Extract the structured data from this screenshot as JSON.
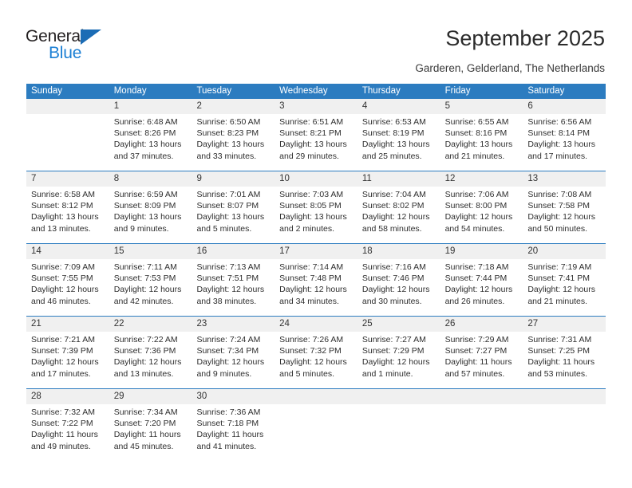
{
  "brand": {
    "name_dark": "General",
    "name_blue": "Blue",
    "accent_blue": "#2c7cc0",
    "logo_blue": "#1b7fd4"
  },
  "header": {
    "title": "September 2025",
    "subtitle": "Garderen, Gelderland, The Netherlands"
  },
  "calendar": {
    "weekdays": [
      "Sunday",
      "Monday",
      "Tuesday",
      "Wednesday",
      "Thursday",
      "Friday",
      "Saturday"
    ],
    "header_bg": "#2c7cc0",
    "daynum_bg": "#f0f0f0",
    "weeks": [
      {
        "days": [
          {
            "num": "",
            "empty": true,
            "l1": "",
            "l2": "",
            "l3": "",
            "l4": ""
          },
          {
            "num": "1",
            "empty": false,
            "l1": "Sunrise: 6:48 AM",
            "l2": "Sunset: 8:26 PM",
            "l3": "Daylight: 13 hours",
            "l4": "and 37 minutes."
          },
          {
            "num": "2",
            "empty": false,
            "l1": "Sunrise: 6:50 AM",
            "l2": "Sunset: 8:23 PM",
            "l3": "Daylight: 13 hours",
            "l4": "and 33 minutes."
          },
          {
            "num": "3",
            "empty": false,
            "l1": "Sunrise: 6:51 AM",
            "l2": "Sunset: 8:21 PM",
            "l3": "Daylight: 13 hours",
            "l4": "and 29 minutes."
          },
          {
            "num": "4",
            "empty": false,
            "l1": "Sunrise: 6:53 AM",
            "l2": "Sunset: 8:19 PM",
            "l3": "Daylight: 13 hours",
            "l4": "and 25 minutes."
          },
          {
            "num": "5",
            "empty": false,
            "l1": "Sunrise: 6:55 AM",
            "l2": "Sunset: 8:16 PM",
            "l3": "Daylight: 13 hours",
            "l4": "and 21 minutes."
          },
          {
            "num": "6",
            "empty": false,
            "l1": "Sunrise: 6:56 AM",
            "l2": "Sunset: 8:14 PM",
            "l3": "Daylight: 13 hours",
            "l4": "and 17 minutes."
          }
        ]
      },
      {
        "days": [
          {
            "num": "7",
            "empty": false,
            "l1": "Sunrise: 6:58 AM",
            "l2": "Sunset: 8:12 PM",
            "l3": "Daylight: 13 hours",
            "l4": "and 13 minutes."
          },
          {
            "num": "8",
            "empty": false,
            "l1": "Sunrise: 6:59 AM",
            "l2": "Sunset: 8:09 PM",
            "l3": "Daylight: 13 hours",
            "l4": "and 9 minutes."
          },
          {
            "num": "9",
            "empty": false,
            "l1": "Sunrise: 7:01 AM",
            "l2": "Sunset: 8:07 PM",
            "l3": "Daylight: 13 hours",
            "l4": "and 5 minutes."
          },
          {
            "num": "10",
            "empty": false,
            "l1": "Sunrise: 7:03 AM",
            "l2": "Sunset: 8:05 PM",
            "l3": "Daylight: 13 hours",
            "l4": "and 2 minutes."
          },
          {
            "num": "11",
            "empty": false,
            "l1": "Sunrise: 7:04 AM",
            "l2": "Sunset: 8:02 PM",
            "l3": "Daylight: 12 hours",
            "l4": "and 58 minutes."
          },
          {
            "num": "12",
            "empty": false,
            "l1": "Sunrise: 7:06 AM",
            "l2": "Sunset: 8:00 PM",
            "l3": "Daylight: 12 hours",
            "l4": "and 54 minutes."
          },
          {
            "num": "13",
            "empty": false,
            "l1": "Sunrise: 7:08 AM",
            "l2": "Sunset: 7:58 PM",
            "l3": "Daylight: 12 hours",
            "l4": "and 50 minutes."
          }
        ]
      },
      {
        "days": [
          {
            "num": "14",
            "empty": false,
            "l1": "Sunrise: 7:09 AM",
            "l2": "Sunset: 7:55 PM",
            "l3": "Daylight: 12 hours",
            "l4": "and 46 minutes."
          },
          {
            "num": "15",
            "empty": false,
            "l1": "Sunrise: 7:11 AM",
            "l2": "Sunset: 7:53 PM",
            "l3": "Daylight: 12 hours",
            "l4": "and 42 minutes."
          },
          {
            "num": "16",
            "empty": false,
            "l1": "Sunrise: 7:13 AM",
            "l2": "Sunset: 7:51 PM",
            "l3": "Daylight: 12 hours",
            "l4": "and 38 minutes."
          },
          {
            "num": "17",
            "empty": false,
            "l1": "Sunrise: 7:14 AM",
            "l2": "Sunset: 7:48 PM",
            "l3": "Daylight: 12 hours",
            "l4": "and 34 minutes."
          },
          {
            "num": "18",
            "empty": false,
            "l1": "Sunrise: 7:16 AM",
            "l2": "Sunset: 7:46 PM",
            "l3": "Daylight: 12 hours",
            "l4": "and 30 minutes."
          },
          {
            "num": "19",
            "empty": false,
            "l1": "Sunrise: 7:18 AM",
            "l2": "Sunset: 7:44 PM",
            "l3": "Daylight: 12 hours",
            "l4": "and 26 minutes."
          },
          {
            "num": "20",
            "empty": false,
            "l1": "Sunrise: 7:19 AM",
            "l2": "Sunset: 7:41 PM",
            "l3": "Daylight: 12 hours",
            "l4": "and 21 minutes."
          }
        ]
      },
      {
        "days": [
          {
            "num": "21",
            "empty": false,
            "l1": "Sunrise: 7:21 AM",
            "l2": "Sunset: 7:39 PM",
            "l3": "Daylight: 12 hours",
            "l4": "and 17 minutes."
          },
          {
            "num": "22",
            "empty": false,
            "l1": "Sunrise: 7:22 AM",
            "l2": "Sunset: 7:36 PM",
            "l3": "Daylight: 12 hours",
            "l4": "and 13 minutes."
          },
          {
            "num": "23",
            "empty": false,
            "l1": "Sunrise: 7:24 AM",
            "l2": "Sunset: 7:34 PM",
            "l3": "Daylight: 12 hours",
            "l4": "and 9 minutes."
          },
          {
            "num": "24",
            "empty": false,
            "l1": "Sunrise: 7:26 AM",
            "l2": "Sunset: 7:32 PM",
            "l3": "Daylight: 12 hours",
            "l4": "and 5 minutes."
          },
          {
            "num": "25",
            "empty": false,
            "l1": "Sunrise: 7:27 AM",
            "l2": "Sunset: 7:29 PM",
            "l3": "Daylight: 12 hours",
            "l4": "and 1 minute."
          },
          {
            "num": "26",
            "empty": false,
            "l1": "Sunrise: 7:29 AM",
            "l2": "Sunset: 7:27 PM",
            "l3": "Daylight: 11 hours",
            "l4": "and 57 minutes."
          },
          {
            "num": "27",
            "empty": false,
            "l1": "Sunrise: 7:31 AM",
            "l2": "Sunset: 7:25 PM",
            "l3": "Daylight: 11 hours",
            "l4": "and 53 minutes."
          }
        ]
      },
      {
        "days": [
          {
            "num": "28",
            "empty": false,
            "l1": "Sunrise: 7:32 AM",
            "l2": "Sunset: 7:22 PM",
            "l3": "Daylight: 11 hours",
            "l4": "and 49 minutes."
          },
          {
            "num": "29",
            "empty": false,
            "l1": "Sunrise: 7:34 AM",
            "l2": "Sunset: 7:20 PM",
            "l3": "Daylight: 11 hours",
            "l4": "and 45 minutes."
          },
          {
            "num": "30",
            "empty": false,
            "l1": "Sunrise: 7:36 AM",
            "l2": "Sunset: 7:18 PM",
            "l3": "Daylight: 11 hours",
            "l4": "and 41 minutes."
          },
          {
            "num": "",
            "empty": true,
            "l1": "",
            "l2": "",
            "l3": "",
            "l4": ""
          },
          {
            "num": "",
            "empty": true,
            "l1": "",
            "l2": "",
            "l3": "",
            "l4": ""
          },
          {
            "num": "",
            "empty": true,
            "l1": "",
            "l2": "",
            "l3": "",
            "l4": ""
          },
          {
            "num": "",
            "empty": true,
            "l1": "",
            "l2": "",
            "l3": "",
            "l4": ""
          }
        ]
      }
    ]
  }
}
